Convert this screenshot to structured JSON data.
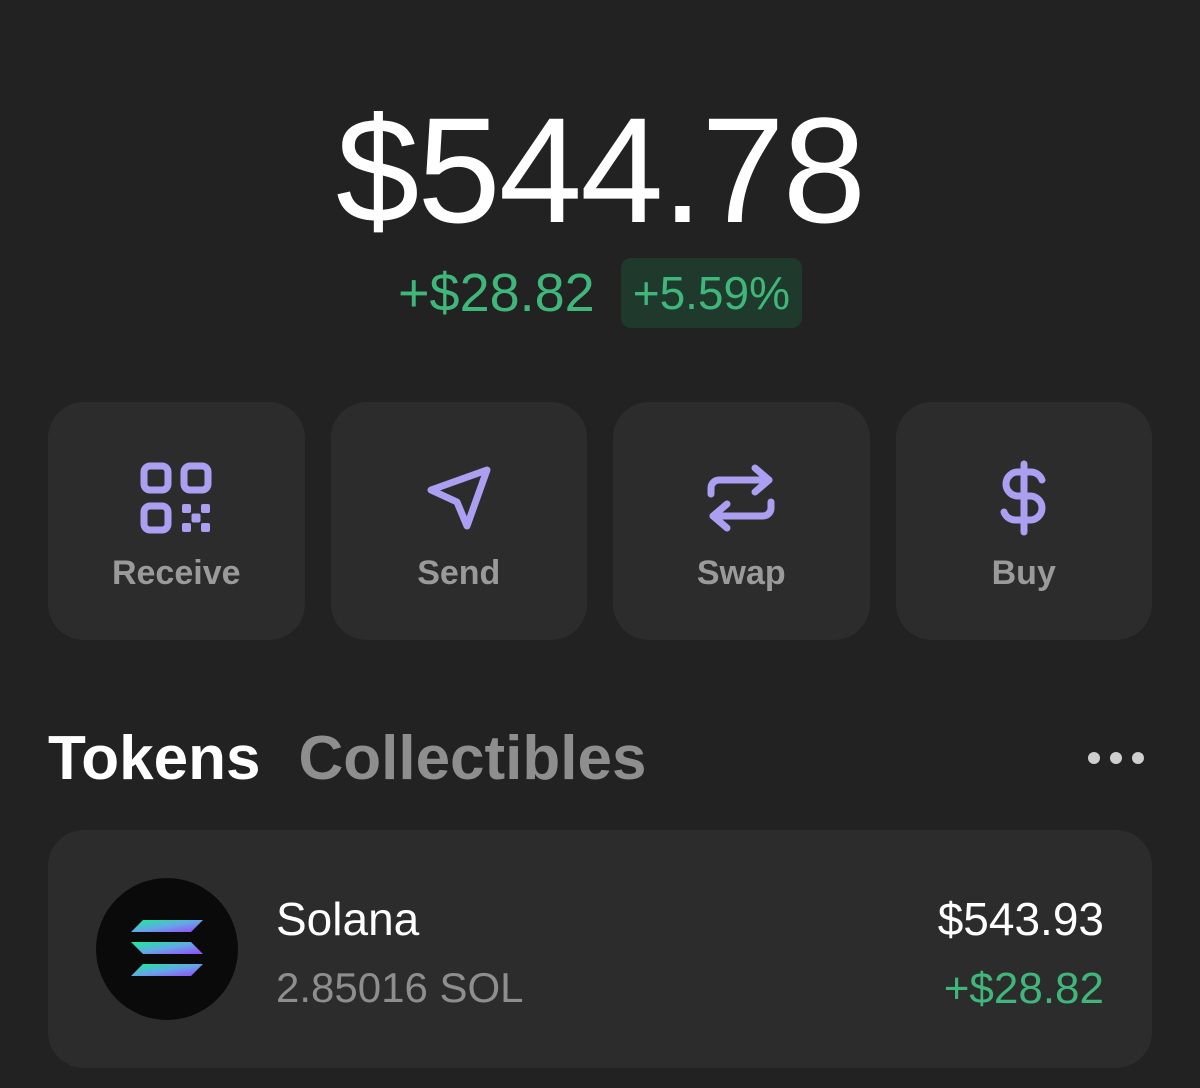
{
  "balance": {
    "total": "$544.78",
    "change_amount": "+$28.82",
    "change_percent": "+5.59%"
  },
  "colors": {
    "background": "#222222",
    "card": "#2c2c2c",
    "accent_purple": "#ab9ff2",
    "positive_green": "#3fb77a"
  },
  "actions": [
    {
      "label": "Receive",
      "icon": "qr-code-icon"
    },
    {
      "label": "Send",
      "icon": "send-icon"
    },
    {
      "label": "Swap",
      "icon": "swap-icon"
    },
    {
      "label": "Buy",
      "icon": "dollar-icon"
    }
  ],
  "tabs": [
    {
      "label": "Tokens",
      "active": true
    },
    {
      "label": "Collectibles",
      "active": false
    }
  ],
  "tokens": [
    {
      "name": "Solana",
      "amount": "2.85016 SOL",
      "value": "$543.93",
      "change": "+$28.82",
      "icon": "solana-logo"
    }
  ]
}
